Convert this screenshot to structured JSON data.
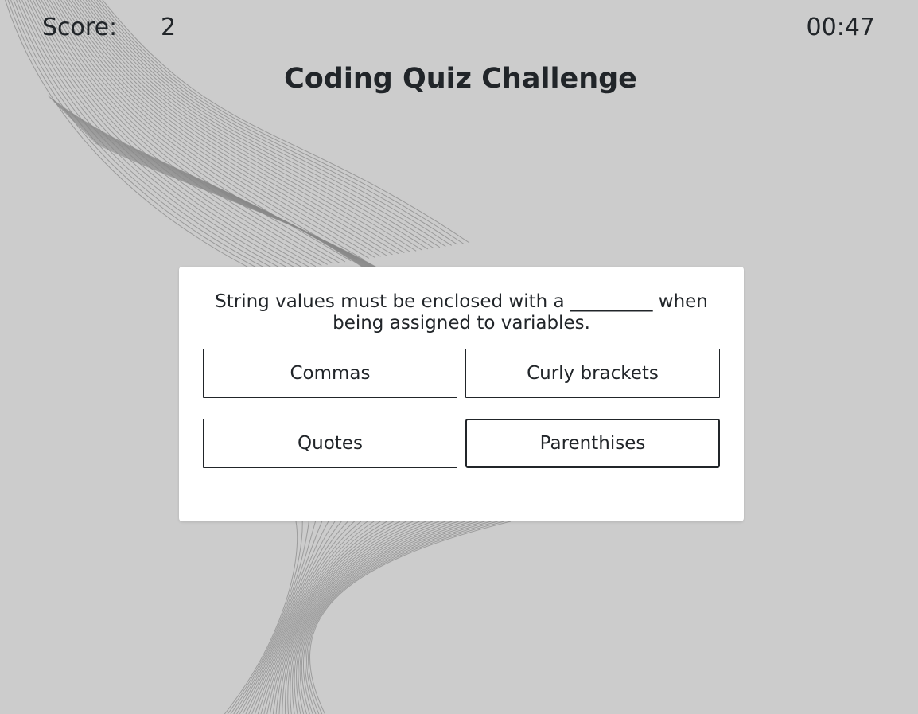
{
  "header": {
    "score_label": "Score:",
    "score_value": "2",
    "timer": "00:47",
    "title": "Coding Quiz Challenge"
  },
  "quiz": {
    "question": "String values must be enclosed with a _________ when being assigned to variables.",
    "answers": [
      {
        "label": "Commas"
      },
      {
        "label": "Curly brackets"
      },
      {
        "label": "Quotes"
      },
      {
        "label": "Parenthises"
      }
    ]
  },
  "colors": {
    "background": "#cccccc",
    "card": "#ffffff",
    "text": "#212529",
    "wave_lines": "#888888"
  }
}
